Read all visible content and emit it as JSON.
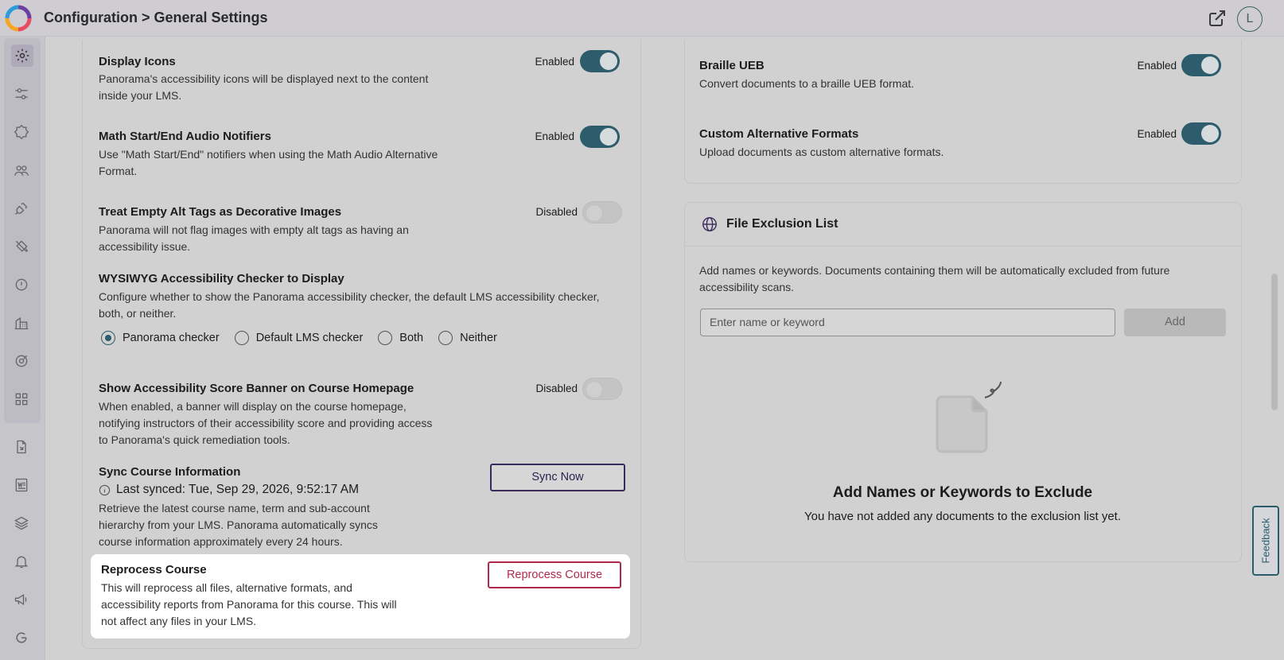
{
  "header": {
    "title": "Configuration > General Settings",
    "avatar_initial": "L"
  },
  "colors": {
    "accent": "#2d5d6c",
    "danger": "#b4294b",
    "button_border": "#3b2a5c"
  },
  "sidebar": {
    "items": [
      {
        "icon": "gear-icon",
        "active": true
      },
      {
        "icon": "sliders-icon"
      },
      {
        "icon": "badge-icon"
      },
      {
        "icon": "users-icon"
      },
      {
        "icon": "plug-icon"
      },
      {
        "icon": "paint-bucket-icon"
      },
      {
        "icon": "info-icon"
      },
      {
        "icon": "building-icon"
      },
      {
        "icon": "target-icon"
      },
      {
        "icon": "grid-icon"
      },
      {
        "icon": "document-import-icon"
      },
      {
        "icon": "word-document-icon"
      },
      {
        "icon": "layers-icon"
      },
      {
        "icon": "bell-icon"
      },
      {
        "icon": "megaphone-icon"
      },
      {
        "icon": "google-icon"
      }
    ]
  },
  "left_settings": {
    "display_icons": {
      "title": "Display Icons",
      "desc_line1": "Panorama's accessibility icons will be displayed next to the content",
      "desc_line2": "inside your LMS.",
      "status": "Enabled"
    },
    "math_notifiers": {
      "title": "Math Start/End Audio Notifiers",
      "desc_line1": "Use \"Math Start/End\" notifiers when using the Math Audio Alternative",
      "desc_line2": "Format.",
      "status": "Enabled"
    },
    "empty_alt": {
      "title": "Treat Empty Alt Tags as Decorative Images",
      "desc_line1": "Panorama will not flag images with empty alt tags as having an",
      "desc_line2": "accessibility issue.",
      "status": "Disabled"
    },
    "wysiwyg": {
      "title": "WYSIWYG Accessibility Checker to Display",
      "desc_line1": "Configure whether to show the Panorama accessibility checker, the default LMS accessibility checker,",
      "desc_line2": "both, or neither.",
      "options": [
        "Panorama checker",
        "Default LMS checker",
        "Both",
        "Neither"
      ],
      "selected": "Panorama checker"
    },
    "score_banner": {
      "title": "Show Accessibility Score Banner on Course Homepage",
      "desc_line1": "When enabled, a banner will display on the course homepage,",
      "desc_line2": "notifying instructors of their accessibility score and providing access",
      "desc_line3": "to Panorama's quick remediation tools.",
      "status": "Disabled"
    },
    "sync": {
      "title": "Sync Course Information",
      "last_synced": "Last synced: Tue, Sep 29, 2026, 9:52:17 AM",
      "desc_line1": "Retrieve the latest course name, term and sub-account",
      "desc_line2": "hierarchy from your LMS. Panorama automatically syncs",
      "desc_line3": "course information approximately every 24 hours.",
      "button": "Sync Now"
    },
    "reprocess": {
      "title": "Reprocess Course",
      "desc_line1": "This will reprocess all files, alternative formats, and",
      "desc_line2": "accessibility reports from Panorama for this course. This will",
      "desc_line3": "not affect any files in your LMS.",
      "button": "Reprocess Course"
    }
  },
  "right_settings": {
    "braille": {
      "title": "Braille UEB",
      "desc": "Convert documents to a braille UEB format.",
      "status": "Enabled"
    },
    "custom_formats": {
      "title": "Custom Alternative Formats",
      "desc": "Upload documents as custom alternative formats.",
      "status": "Enabled"
    }
  },
  "file_exclusion": {
    "title": "File Exclusion List",
    "desc_line1": "Add names or keywords. Documents containing them will be automatically excluded from future",
    "desc_line2": "accessibility scans.",
    "input_placeholder": "Enter name or keyword",
    "add_button": "Add",
    "empty_title": "Add Names or Keywords to Exclude",
    "empty_desc": "You have not added any documents to the exclusion list yet."
  },
  "feedback": "Feedback"
}
